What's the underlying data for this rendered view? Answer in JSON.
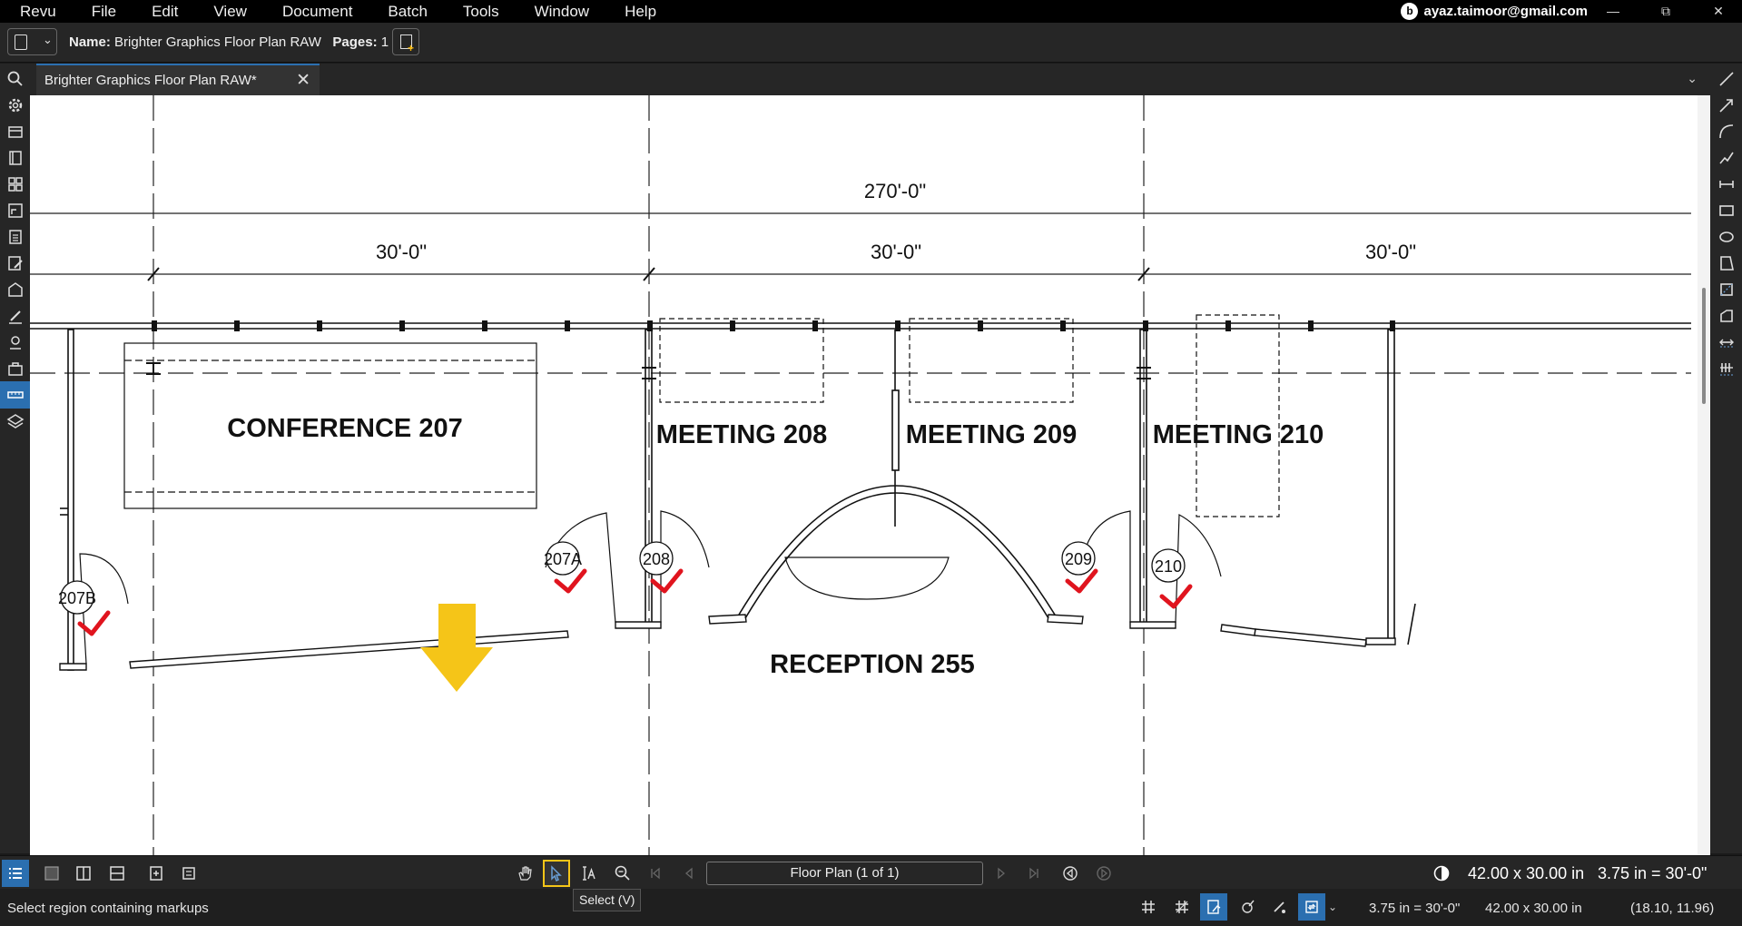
{
  "menu": [
    "Revu",
    "File",
    "Edit",
    "View",
    "Document",
    "Batch",
    "Tools",
    "Window",
    "Help"
  ],
  "user": {
    "email": "ayaz.taimoor@gmail.com"
  },
  "doc": {
    "name_label": "Name:",
    "name": "Brighter Graphics Floor Plan RAW",
    "pages_label": "Pages:",
    "pages": "1"
  },
  "tab": {
    "title": "Brighter Graphics Floor Plan RAW*"
  },
  "plan": {
    "dim_total": "270'-0\"",
    "dim_bay_1": "30'-0\"",
    "dim_bay_2": "30'-0\"",
    "dim_bay_3": "30'-0\"",
    "rooms": {
      "conference": "CONFERENCE  207",
      "meeting_208": "MEETING  208",
      "meeting_209": "MEETING  209",
      "meeting_210": "MEETING  210",
      "reception": "RECEPTION  255"
    },
    "doors": {
      "d207b": "207B",
      "d207a": "207A",
      "d208": "208",
      "d209": "209",
      "d210": "210"
    },
    "check_color": "#e0141e",
    "arrow_color": "#f5c518"
  },
  "nav": {
    "page": "Floor Plan (1 of 1)",
    "size": "42.00 x 30.00 in",
    "scale": "3.75 in = 30'-0\""
  },
  "tooltip": "Select (V)",
  "status": {
    "message": "Select region containing markups",
    "calibration": "3.75 in = 30'-0\"",
    "size": "42.00 x 30.00 in",
    "coords": "(18.10, 11.96)"
  },
  "accent": "#2b6fb0"
}
